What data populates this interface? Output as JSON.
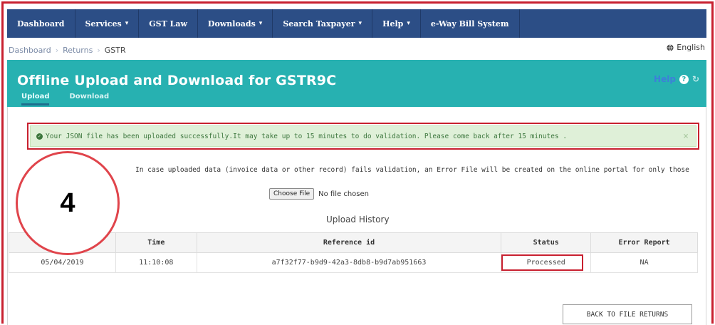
{
  "navbar": {
    "items": [
      {
        "label": "Dashboard",
        "dropdown": false
      },
      {
        "label": "Services",
        "dropdown": true
      },
      {
        "label": "GST Law",
        "dropdown": false
      },
      {
        "label": "Downloads",
        "dropdown": true
      },
      {
        "label": "Search Taxpayer",
        "dropdown": true
      },
      {
        "label": "Help",
        "dropdown": true
      },
      {
        "label": "e-Way Bill System",
        "dropdown": false
      }
    ],
    "caret": "▾"
  },
  "breadcrumb": {
    "items": [
      "Dashboard",
      "Returns",
      "GSTR"
    ],
    "separator": "›"
  },
  "language": {
    "label": "English",
    "icon": "globe-icon"
  },
  "header": {
    "title": "Offline Upload and Download for GSTR9C",
    "help_label": "Help",
    "tabs": [
      {
        "label": "Upload",
        "active": true
      },
      {
        "label": "Download",
        "active": false
      }
    ]
  },
  "alert": {
    "message": "Your JSON file has been uploaded successfully.It may take up to 15 minutes to do validation. Please come back after 15 minutes .",
    "close_label": "×"
  },
  "info_text": "In case uploaded data (invoice data or other record) fails validation, an Error File will be created on the online portal for only those",
  "file_input": {
    "button_label": "Choose File",
    "status": "No file chosen"
  },
  "history": {
    "title": "Upload History",
    "columns": [
      "",
      "Time",
      "Reference id",
      "Status",
      "Error Report"
    ],
    "rows": [
      {
        "date": "05/04/2019",
        "time": "11:10:08",
        "reference_id": "a7f32f77-b9d9-42a3-8db8-b9d7ab951663",
        "status": "Processed",
        "error_report": "NA"
      }
    ]
  },
  "back_button_label": "BACK TO FILE RETURNS",
  "callout_number": "4",
  "colors": {
    "navbar": "#2c4e86",
    "header": "#27b1b1",
    "alert_bg": "#dff0d8",
    "highlight": "#c8202f"
  }
}
